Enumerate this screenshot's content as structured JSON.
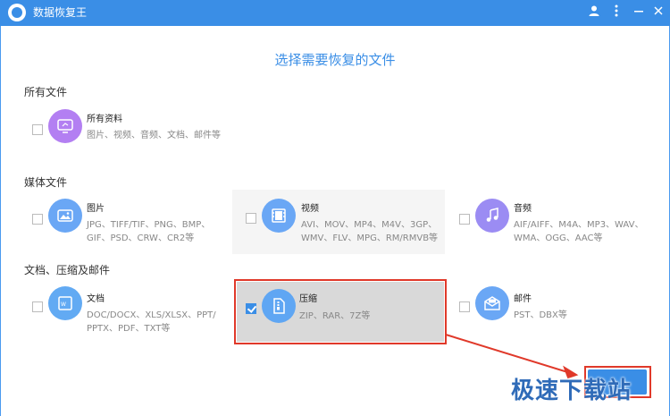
{
  "app": {
    "title": "数据恢复王"
  },
  "page": {
    "title": "选择需要恢复的文件"
  },
  "sections": [
    {
      "title": "所有文件",
      "items": [
        {
          "name": "所有资料",
          "desc": "图片、视频、音频、文档、邮件等",
          "checked": false,
          "icon": "all-files-icon",
          "color": "#b37ff2"
        }
      ]
    },
    {
      "title": "媒体文件",
      "items": [
        {
          "name": "图片",
          "desc": "JPG、TIFF/TIF、PNG、BMP、\nGIF、PSD、CRW、CR2等",
          "checked": false,
          "icon": "image-icon",
          "color": "#6aa7f5"
        },
        {
          "name": "视频",
          "desc": "AVI、MOV、MP4、M4V、3GP、\nWMV、FLV、MPG、RM/RMVB等",
          "checked": false,
          "icon": "video-icon",
          "color": "#6aa7f5"
        },
        {
          "name": "音频",
          "desc": "AIF/AIFF、M4A、MP3、WAV、\nWMA、OGG、AAC等",
          "checked": false,
          "icon": "audio-icon",
          "color": "#9b8cf3"
        }
      ]
    },
    {
      "title": "文档、压缩及邮件",
      "items": [
        {
          "name": "文档",
          "desc": "DOC/DOCX、XLS/XLSX、PPT/\nPPTX、PDF、TXT等",
          "checked": false,
          "icon": "document-icon",
          "color": "#62aaf3"
        },
        {
          "name": "压缩",
          "desc": "ZIP、RAR、7Z等",
          "checked": true,
          "icon": "archive-icon",
          "color": "#5fa6f3"
        },
        {
          "name": "邮件",
          "desc": "PST、DBX等",
          "checked": false,
          "icon": "mail-icon",
          "color": "#6aa7f5"
        }
      ]
    }
  ],
  "watermark": "极速下载站",
  "colors": {
    "accent": "#3a8ee6",
    "highlight": "#e0392a"
  }
}
